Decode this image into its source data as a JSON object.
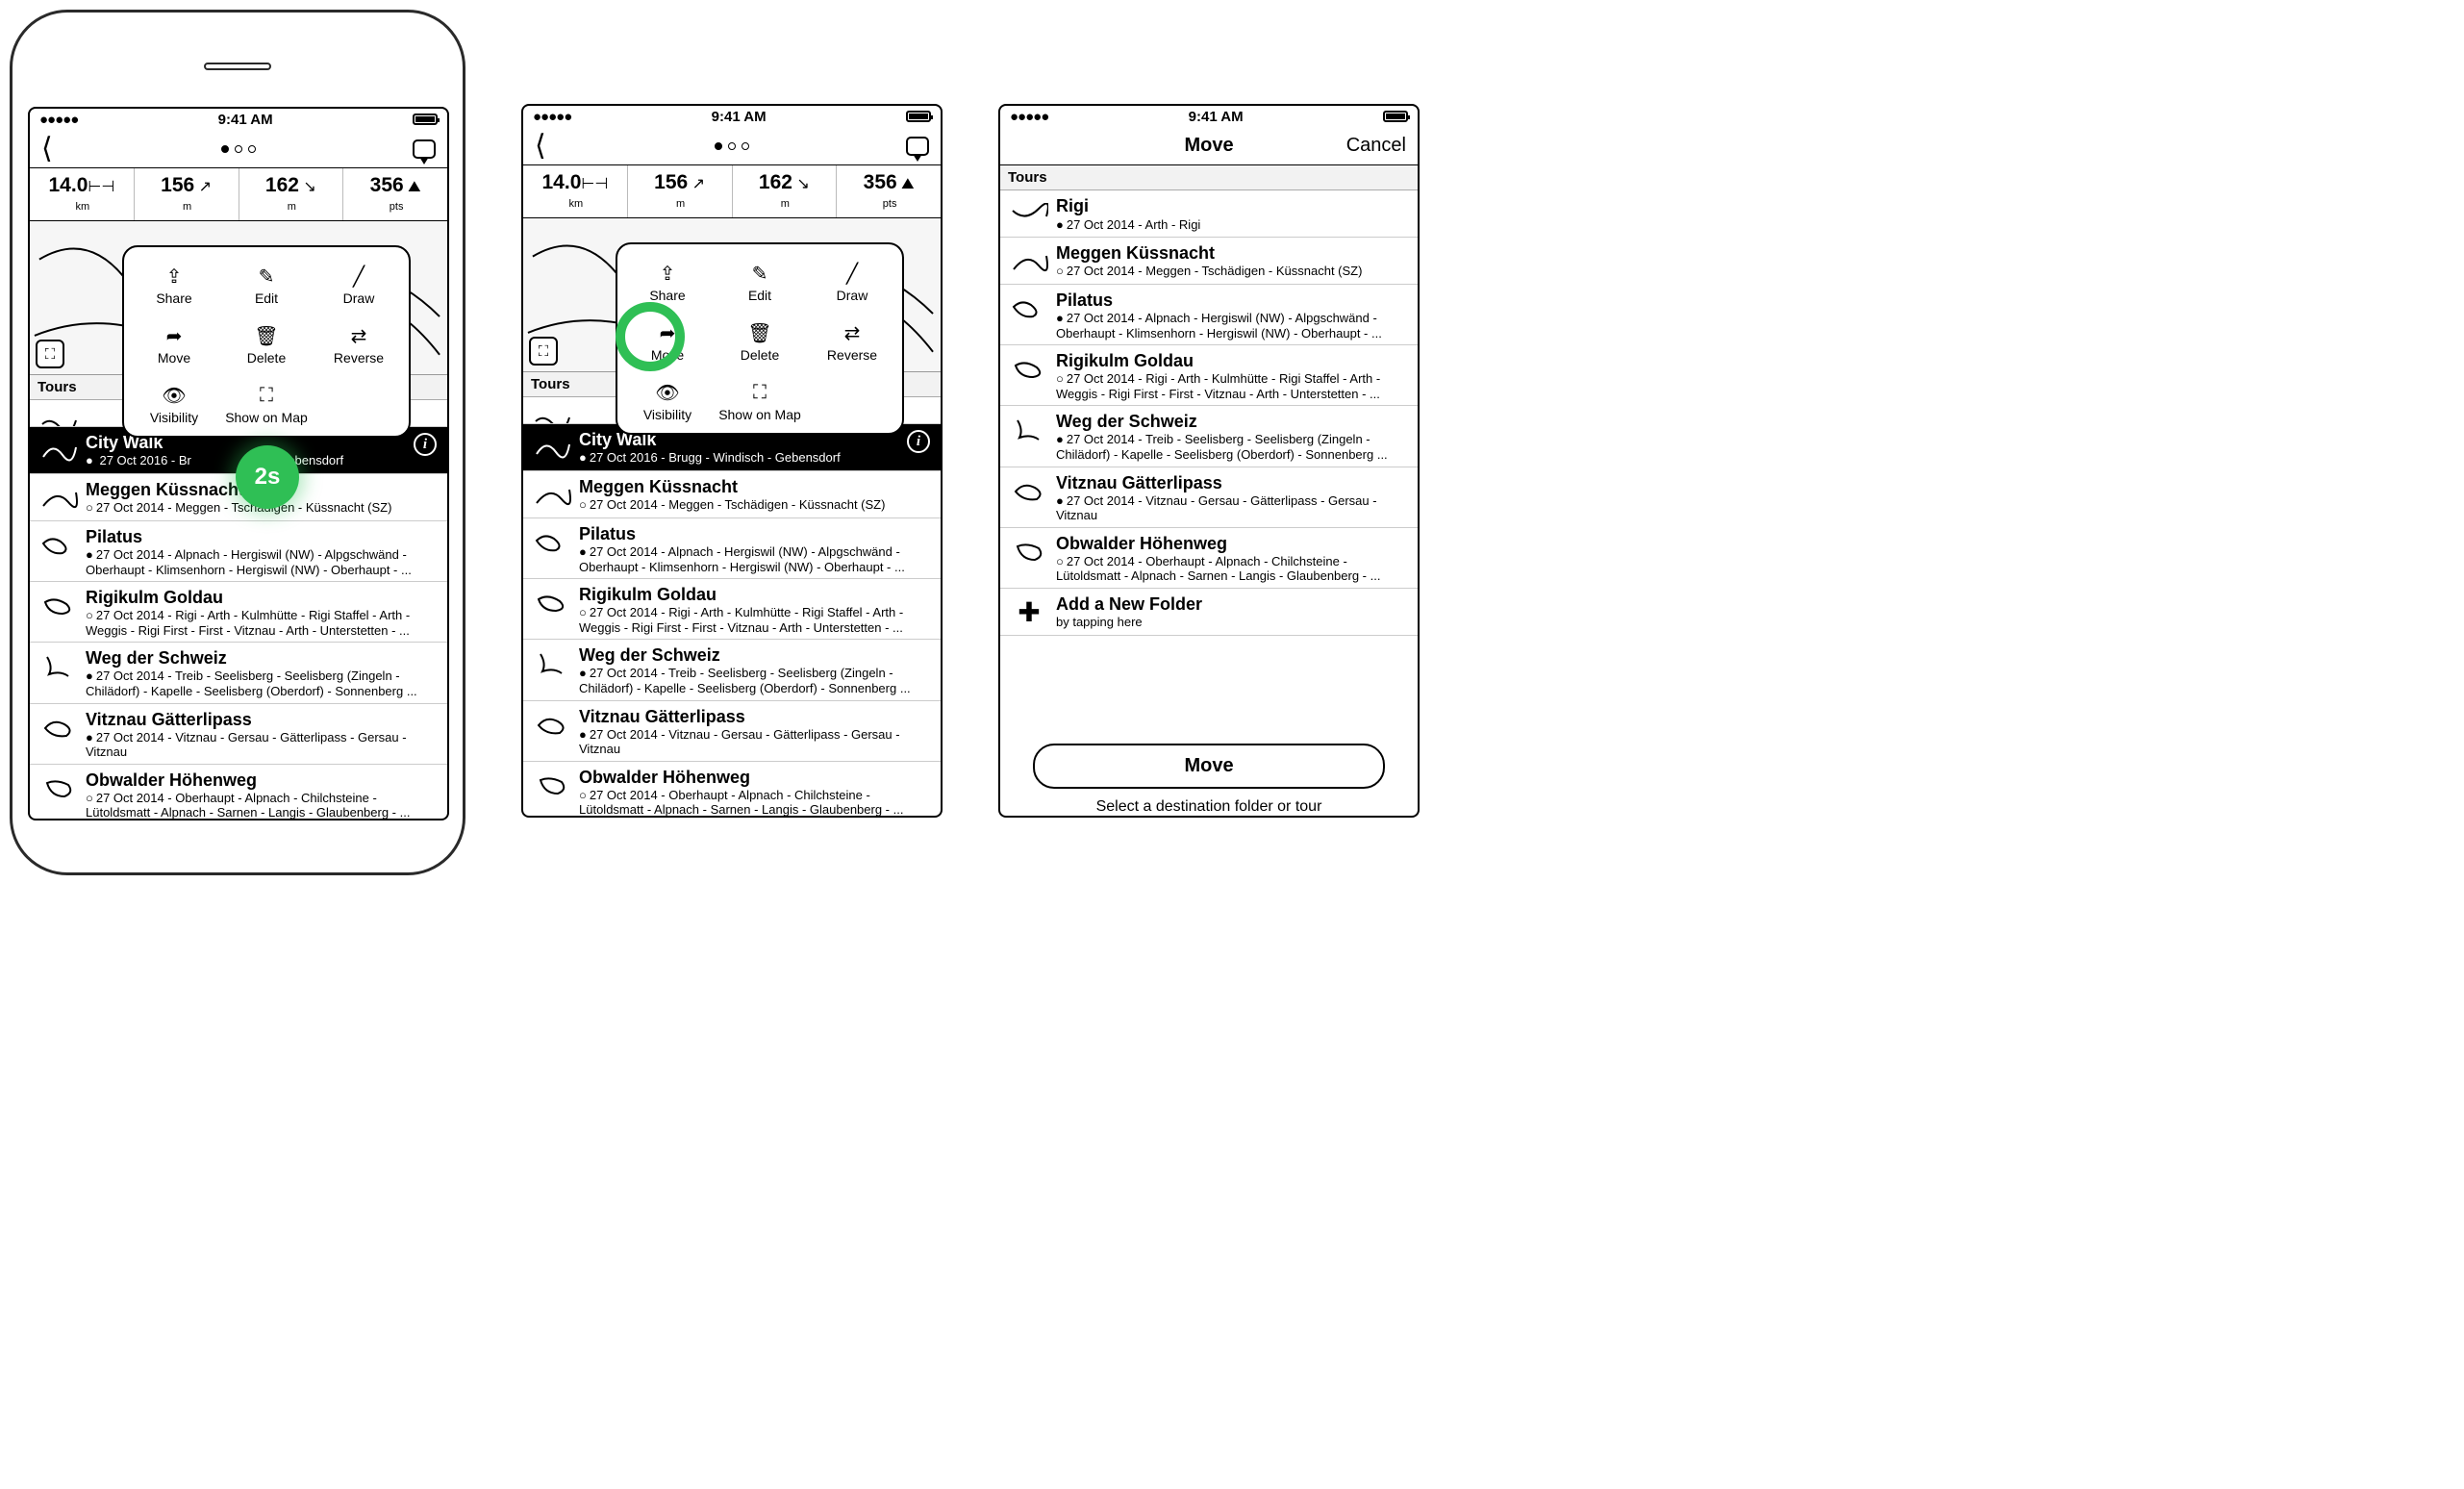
{
  "status": {
    "time": "9:41 AM"
  },
  "stats": [
    {
      "v": "14.0",
      "u": "km"
    },
    {
      "v": "156",
      "u": "m"
    },
    {
      "v": "162",
      "u": "m"
    },
    {
      "v": "356",
      "u": "pts"
    }
  ],
  "section": {
    "tours": "Tours"
  },
  "popover": {
    "share": "Share",
    "edit": "Edit",
    "draw": "Draw",
    "move": "Move",
    "delete": "Delete",
    "reverse": "Reverse",
    "visibility": "Visibility",
    "show": "Show on Map"
  },
  "hl": {
    "badge": "2s"
  },
  "tours": {
    "city": {
      "t": "City Walk",
      "m": "27 Oct 2016 - Brugg - Windisch - Gebensdorf"
    },
    "city_crop": {
      "m": "27 Oct 2016 - Br",
      "m2": "ch - Gebensdorf"
    },
    "rigi": {
      "t": "Rigi",
      "m": "27 Oct 2014 - Arth - Rigi"
    },
    "meggen": {
      "t": "Meggen Küssnacht",
      "m": "27 Oct 2014 - Meggen - Tschädigen - Küssnacht (SZ)"
    },
    "pilatus": {
      "t": "Pilatus",
      "m": "27 Oct 2014 - Alpnach - Hergiswil (NW) - Alpgschwänd - Oberhaupt - Klimsenhorn - Hergiswil (NW) - Oberhaupt - ..."
    },
    "rigikulm": {
      "t": "Rigikulm Goldau",
      "m": "27 Oct 2014 - Rigi - Arth - Kulmhütte - Rigi Staffel - Arth - Weggis - Rigi First - First - Vitznau - Arth - Unterstetten - ..."
    },
    "weg": {
      "t": "Weg der Schweiz",
      "m": "27 Oct 2014 - Treib - Seelisberg - Seelisberg (Zingeln - Chilädorf) - Kapelle - Seelisberg (Oberdorf) - Sonnenberg ..."
    },
    "vitznau": {
      "t": "Vitznau Gätterlipass",
      "m": "27 Oct 2014 - Vitznau - Gersau - Gätterlipass - Gersau - Vitznau"
    },
    "obwalder": {
      "t": "Obwalder Höhenweg",
      "m": "27 Oct 2014 - Oberhaupt - Alpnach - Chilchsteine - Lütoldsmatt - Alpnach - Sarnen - Langis - Glaubenberg - ..."
    }
  },
  "addFolder": {
    "t": "Add a New Folder",
    "m": "by tapping here"
  },
  "moveScreen": {
    "title": "Move",
    "cancel": "Cancel",
    "btn": "Move",
    "hint": "Select a destination folder or tour"
  }
}
